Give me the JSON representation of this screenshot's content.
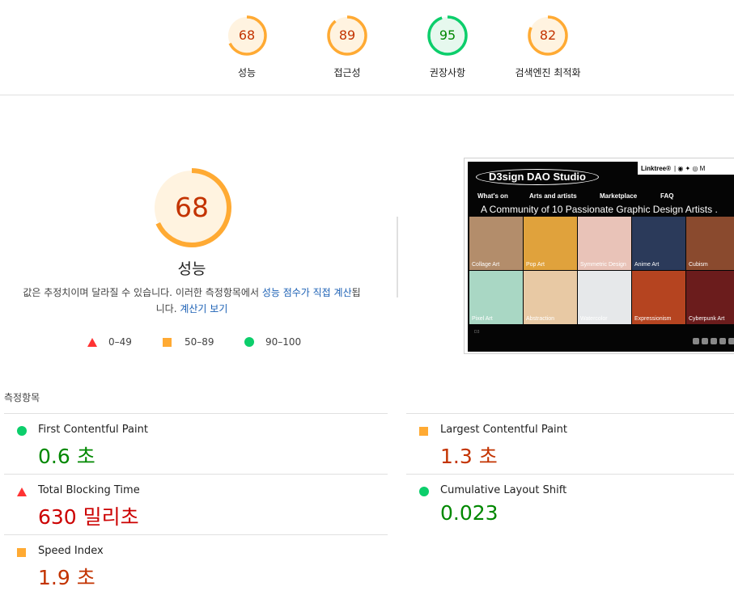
{
  "colors": {
    "fail": "#ff3333",
    "average": "#ffaa33",
    "pass": "#0cce6b",
    "average_text": "#c33300",
    "pass_text": "#008800",
    "fail_text": "#cc0000",
    "link": "#1a5fb4"
  },
  "scores": [
    {
      "value": "68",
      "label": "성능",
      "score": 68,
      "rating": "average"
    },
    {
      "value": "89",
      "label": "접근성",
      "score": 89,
      "rating": "average"
    },
    {
      "value": "95",
      "label": "권장사항",
      "score": 95,
      "rating": "pass"
    },
    {
      "value": "82",
      "label": "검색엔진 최적화",
      "score": 82,
      "rating": "average"
    }
  ],
  "performance": {
    "score": "68",
    "title": "성능",
    "description_prefix": "값은 추정치이며 달라질 수 있습니다. 이러한 측정항목에서 ",
    "description_link": "성능 점수가 직접 계산",
    "description_middle": "됩니다. ",
    "calculator_link": "계산기 보기"
  },
  "legend": [
    {
      "shape": "triangle",
      "range": "0–49"
    },
    {
      "shape": "square",
      "range": "50–89"
    },
    {
      "shape": "circle",
      "range": "90–100"
    }
  ],
  "screenshot": {
    "linktree": "Linktree®",
    "logo": "D3sign DAO Studio",
    "nav": [
      "What's on",
      "Arts and artists",
      "Marketplace",
      "FAQ"
    ],
    "tagline": "A Community of 10 Passionate Graphic Design Artists .",
    "tiles": [
      {
        "caption": "Collage Art",
        "color": "#b38d6b"
      },
      {
        "caption": "Pop Art",
        "color": "#e0a23c"
      },
      {
        "caption": "Symmetric Design",
        "color": "#e9c3b8"
      },
      {
        "caption": "Anime Art",
        "color": "#2b3a5a"
      },
      {
        "caption": "Cubism",
        "color": "#8a4a2e"
      },
      {
        "caption": "Pixel Art",
        "color": "#a9d7c4"
      },
      {
        "caption": "Abstraction",
        "color": "#e8c9a4"
      },
      {
        "caption": "Watercolor",
        "color": "#e6e8ea"
      },
      {
        "caption": "Expressionism",
        "color": "#b54420"
      },
      {
        "caption": "Cyberpunk Art",
        "color": "#6b1c1c"
      }
    ]
  },
  "metrics_title": "측정항목",
  "metrics": [
    {
      "name": "First Contentful Paint",
      "value": "0.6 초",
      "rating": "pass"
    },
    {
      "name": "Largest Contentful Paint",
      "value": "1.3 초",
      "rating": "average"
    },
    {
      "name": "Total Blocking Time",
      "value": "630 밀리초",
      "rating": "fail"
    },
    {
      "name": "Cumulative Layout Shift",
      "value": "0.023",
      "rating": "pass"
    },
    {
      "name": "Speed Index",
      "value": "1.9 초",
      "rating": "average"
    }
  ]
}
